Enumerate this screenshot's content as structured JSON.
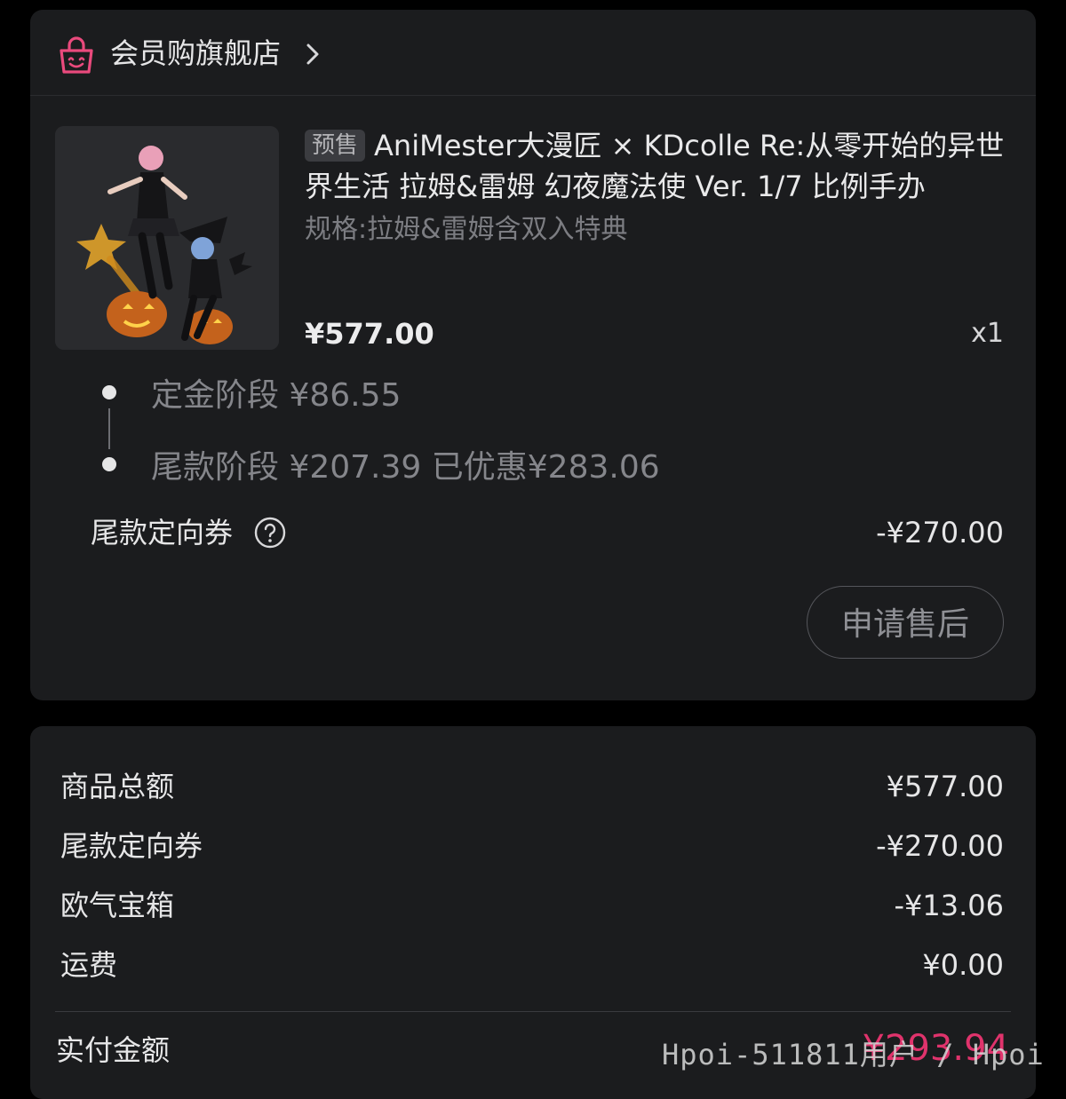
{
  "store": {
    "icon": "shopping-bag-smile-icon",
    "name": "会员购旗舰店",
    "accent_color": "#ea4a7d"
  },
  "product": {
    "tag": "预售",
    "title": "AniMester大漫匠 × KDcolle Re:从零开始的异世界生活 拉姆&雷姆 幻夜魔法使 Ver. 1/7 比例手办",
    "spec": "规格:拉姆&雷姆含双入特典",
    "price": "¥577.00",
    "quantity": "x1"
  },
  "stages": [
    {
      "text": "定金阶段 ¥86.55"
    },
    {
      "text": "尾款阶段 ¥207.39 已优惠¥283.06"
    }
  ],
  "coupon": {
    "label": "尾款定向券",
    "value": "-¥270.00",
    "help_icon": "question-circle-icon"
  },
  "aftersale_button": "申请售后",
  "summary": {
    "rows": [
      {
        "label": "商品总额",
        "value": "¥577.00"
      },
      {
        "label": "尾款定向券",
        "value": "-¥270.00"
      },
      {
        "label": "欧气宝箱",
        "value": "-¥13.06"
      },
      {
        "label": "运费",
        "value": "¥0.00"
      }
    ],
    "paid_label": "实付金额",
    "paid_value": "¥293.94",
    "paid_color": "#e0336c"
  },
  "watermark": "Hpoi-511811用户 / Hpoi"
}
